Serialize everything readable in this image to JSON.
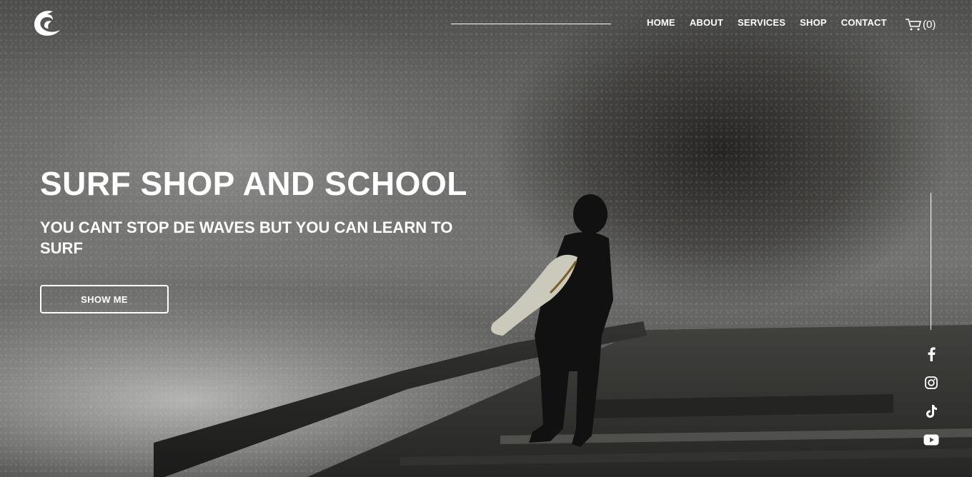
{
  "nav": {
    "items": [
      {
        "label": "HOME"
      },
      {
        "label": "ABOUT"
      },
      {
        "label": "SERVICES"
      },
      {
        "label": "SHOP"
      },
      {
        "label": "CONTACT"
      }
    ],
    "cart_count": "(0)"
  },
  "hero": {
    "title": "SURF SHOP AND SCHOOL",
    "subtitle": "YOU CANT STOP DE WAVES BUT YOU CAN LEARN TO SURF",
    "button_label": "SHOW ME"
  },
  "icons": {
    "logo": "wave-logo-icon",
    "cart": "cart-icon",
    "social": [
      "facebook-icon",
      "instagram-icon",
      "tiktok-icon",
      "youtube-icon"
    ]
  },
  "colors": {
    "text": "#ffffff",
    "overlay": "#000000"
  }
}
